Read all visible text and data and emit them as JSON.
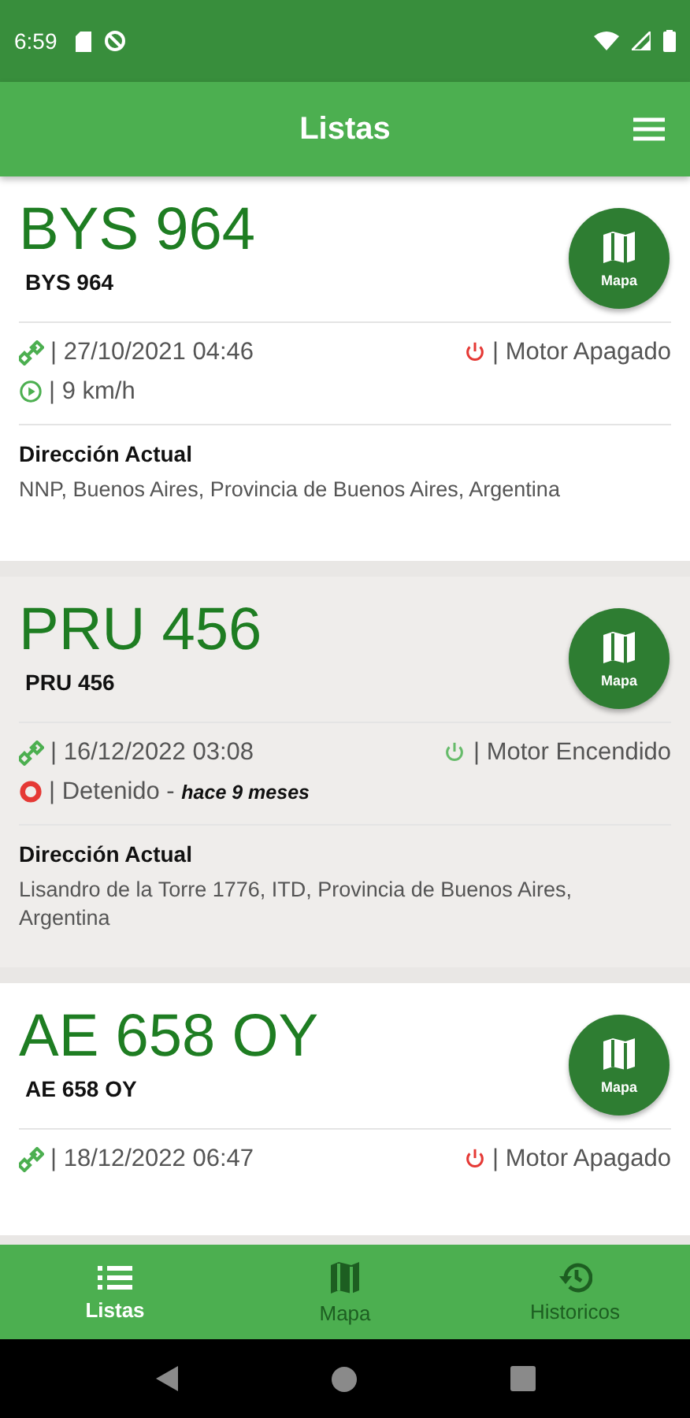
{
  "status_bar": {
    "time": "6:59"
  },
  "app_bar": {
    "title": "Listas"
  },
  "vehicles": [
    {
      "plate": "BYS 964",
      "subtitle": "BYS 964",
      "selected": false,
      "timestamp": "| 27/10/2021 04:46",
      "engine_on": false,
      "engine": "| Motor Apagado",
      "motion": {
        "kind": "moving",
        "text": "| 9 km/h"
      },
      "address_label": "Dirección Actual",
      "address": "NNP, Buenos Aires, Provincia de Buenos Aires, Argentina",
      "map_label": "Mapa"
    },
    {
      "plate": "PRU 456",
      "subtitle": "PRU 456",
      "selected": true,
      "timestamp": "| 16/12/2022 03:08",
      "engine_on": true,
      "engine": "| Motor Encendido",
      "motion": {
        "kind": "stopped",
        "text": "| Detenido -",
        "since": "hace 9 meses"
      },
      "address_label": "Dirección Actual",
      "address": "Lisandro de la Torre 1776, ITD, Provincia de Buenos Aires, Argentina",
      "map_label": "Mapa"
    },
    {
      "plate": "AE 658 OY",
      "subtitle": "AE 658 OY",
      "selected": false,
      "timestamp": "| 18/12/2022 06:47",
      "engine_on": false,
      "engine": "| Motor Apagado",
      "map_label": "Mapa"
    }
  ],
  "bottom_nav": [
    {
      "label": "Listas",
      "selected": true
    },
    {
      "label": "Mapa",
      "selected": false
    },
    {
      "label": "Historicos",
      "selected": false
    }
  ]
}
